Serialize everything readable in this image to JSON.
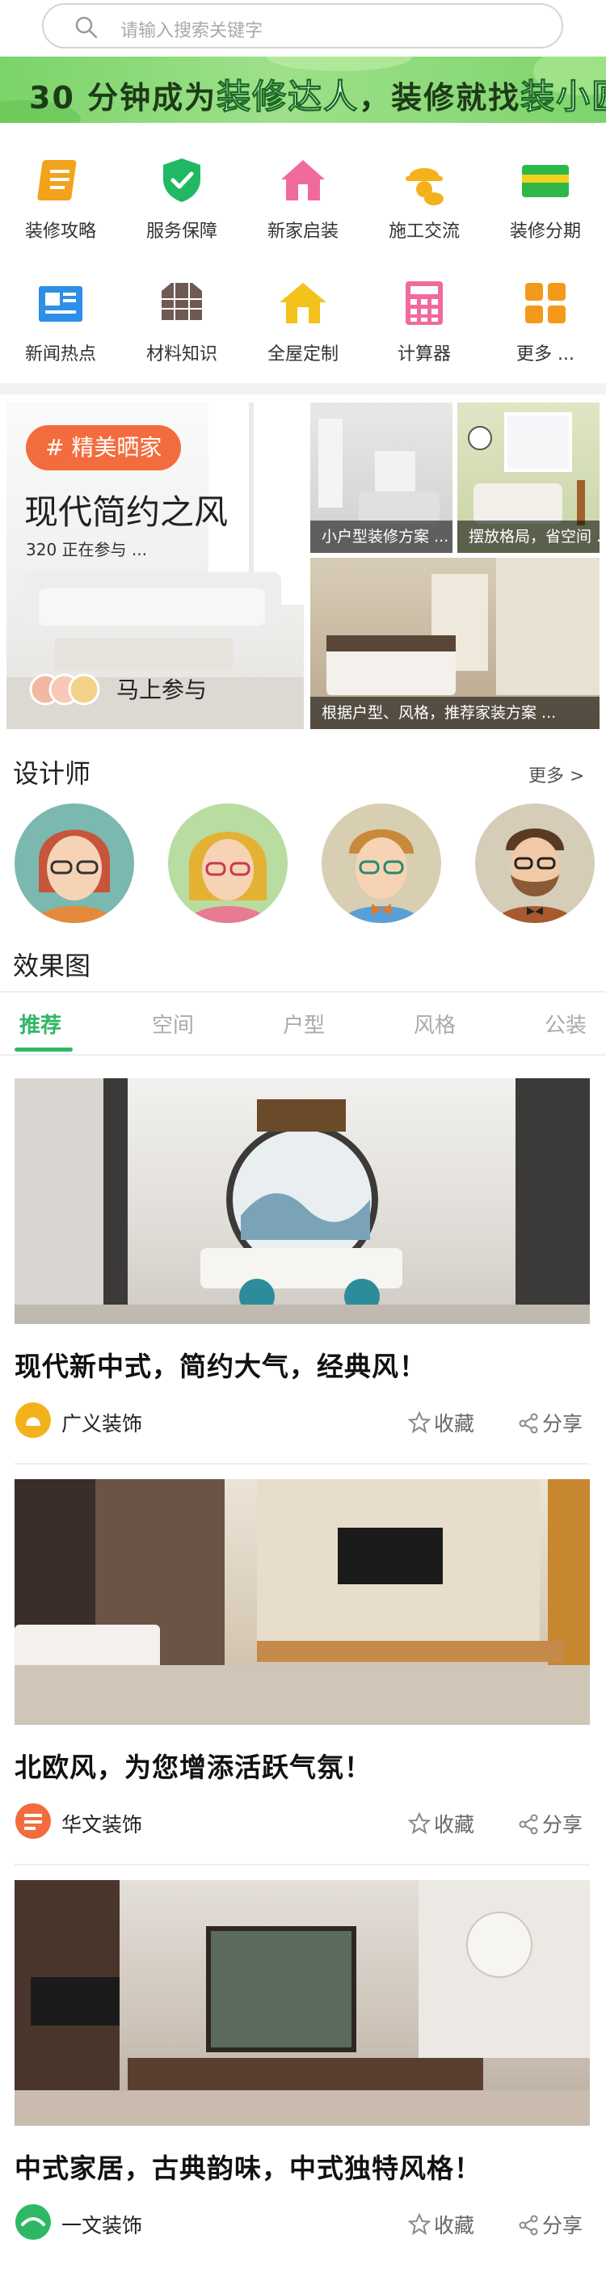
{
  "search": {
    "placeholder": "请输入搜索关键字"
  },
  "banner": {
    "pre": "30 分钟成为",
    "hl1": "装修达人",
    "mid": "，装修就找",
    "hl2": "装小匠",
    "post": "！"
  },
  "categories": [
    {
      "label": "装修攻略",
      "icon": "book-icon",
      "color": "#f3a21b"
    },
    {
      "label": "服务保障",
      "icon": "shield-check-icon",
      "color": "#21b864"
    },
    {
      "label": "新家启装",
      "icon": "house-icon",
      "color": "#f06a9e"
    },
    {
      "label": "施工交流",
      "icon": "worker-icon",
      "color": "#f3b21b"
    },
    {
      "label": "装修分期",
      "icon": "card-icon",
      "color": "#2eb84a"
    },
    {
      "label": "新闻热点",
      "icon": "news-icon",
      "color": "#2e8fe8"
    },
    {
      "label": "材料知识",
      "icon": "tiles-icon",
      "color": "#6e5a52"
    },
    {
      "label": "全屋定制",
      "icon": "home-icon",
      "color": "#f3c21b"
    },
    {
      "label": "计算器",
      "icon": "calculator-icon",
      "color": "#f06a9e"
    },
    {
      "label": "更多 ...",
      "icon": "grid-icon",
      "color": "#f39a1b"
    }
  ],
  "gallery": {
    "badge": "# 精美晒家",
    "title": "现代简约之风",
    "subtitle": "320 正在参与 ...",
    "join": "马上参与",
    "tiles": [
      {
        "caption": "小户型装修方案 ..."
      },
      {
        "caption": "摆放格局，省空间 ..."
      },
      {
        "caption": "根据户型、风格，推荐家装方案 ..."
      }
    ]
  },
  "designers": {
    "title": "设计师",
    "more": "更多 >"
  },
  "effects": {
    "title": "效果图",
    "tabs": [
      "推荐",
      "空间",
      "户型",
      "风格",
      "公装"
    ],
    "active_tab": 0,
    "accent": "#2eb866"
  },
  "feed": [
    {
      "title": "现代新中式，简约大气，经典风！",
      "company": "广义装饰",
      "logo_color": "#f3b21b",
      "fav": "收藏",
      "share": "分享"
    },
    {
      "title": "北欧风，为您增添活跃气氛！",
      "company": "华文装饰",
      "logo_color": "#f26c3d",
      "fav": "收藏",
      "share": "分享"
    },
    {
      "title": "中式家居，古典韵味，中式独特风格！",
      "company": "一文装饰",
      "logo_color": "#2eb866",
      "fav": "收藏",
      "share": "分享"
    }
  ]
}
